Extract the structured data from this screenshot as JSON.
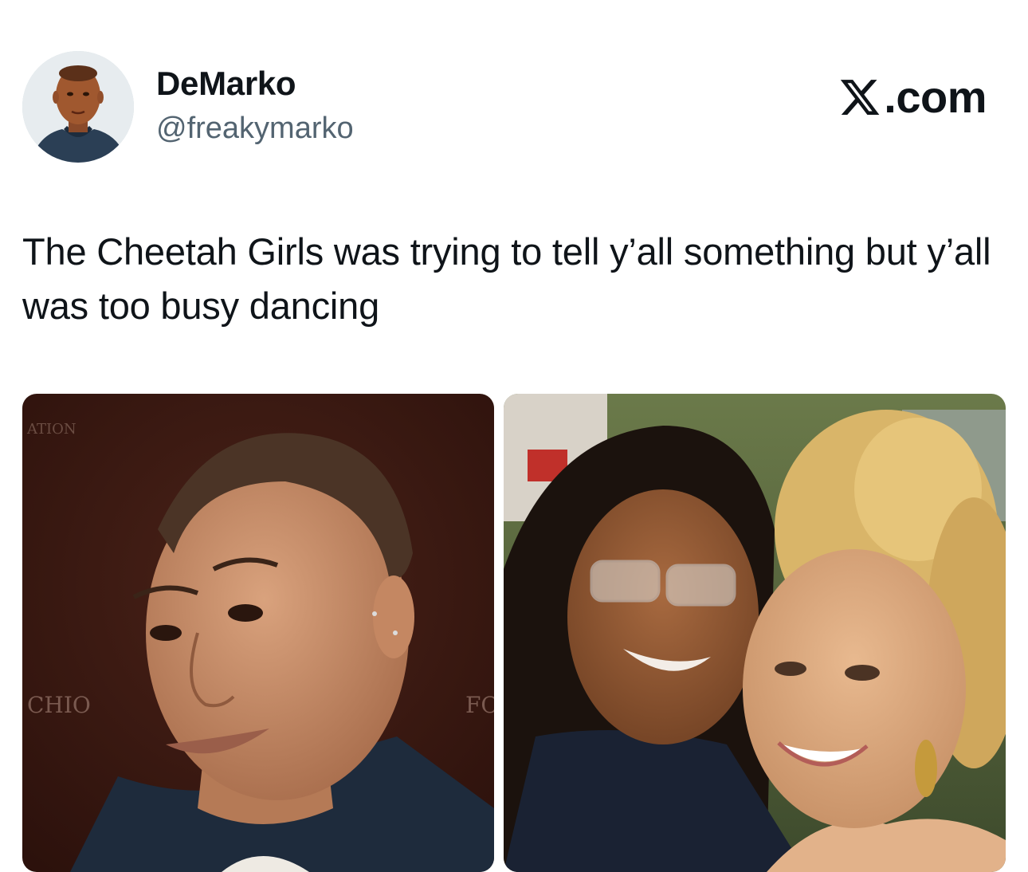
{
  "author": {
    "display_name": "DeMarko",
    "handle": "@freakymarko"
  },
  "brand": {
    "label": ".com",
    "icon": "x-logo-icon"
  },
  "tweet": {
    "text": "The Cheetah Girls was trying to tell y’all something but y’all was too busy dancing"
  },
  "media": {
    "left_photo": {
      "backdrop_text_1": "CHIO",
      "backdrop_text_2": "FC"
    },
    "right_photo": {}
  }
}
